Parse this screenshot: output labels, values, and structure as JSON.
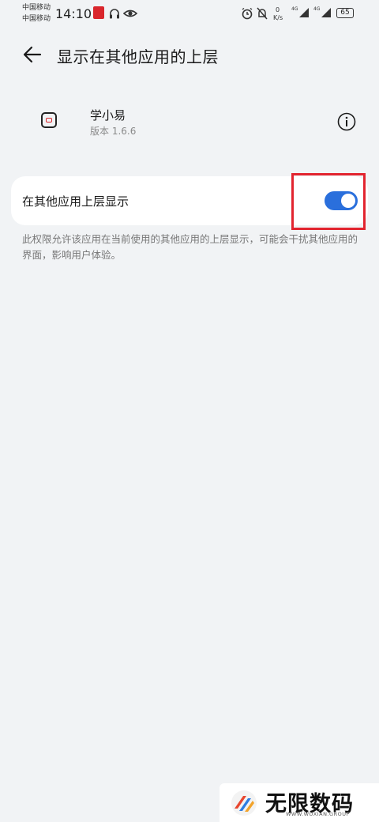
{
  "status_bar": {
    "carrier1": "中国移动",
    "carrier2": "中国移动",
    "time": "14:10",
    "net_speed_value": "0",
    "net_speed_unit": "K/s",
    "sim1_net": "4G",
    "sim2_net": "4G",
    "battery": "65"
  },
  "header": {
    "title": "显示在其他应用的上层"
  },
  "app": {
    "name": "学小易",
    "version": "版本 1.6.6"
  },
  "setting": {
    "label": "在其他应用上层显示",
    "enabled": true,
    "description": "此权限允许该应用在当前使用的其他应用的上层显示，可能会干扰其他应用的界面，影响用户体验。"
  },
  "colors": {
    "toggle_on": "#2a6fdc",
    "highlight": "#e2242f"
  },
  "watermark": {
    "text": "无限数码",
    "subtext": "WWW.WUXIAN.GROUP"
  }
}
